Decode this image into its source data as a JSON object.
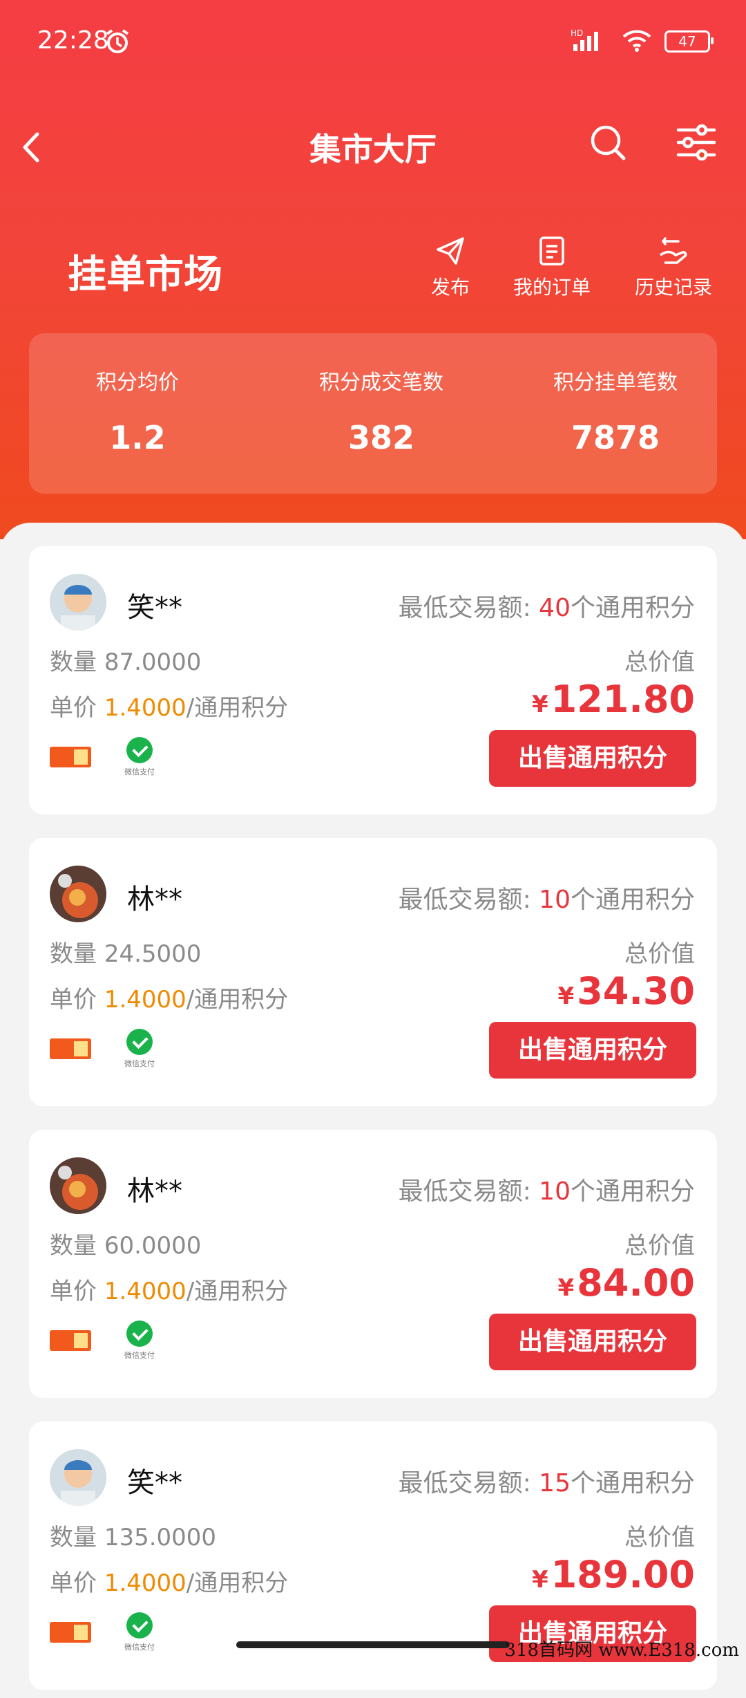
{
  "status_bar": {
    "time": "22:28",
    "network": "HD",
    "battery": "47"
  },
  "nav": {
    "title": "集市大厅"
  },
  "market": {
    "title": "挂单市场",
    "actions": [
      {
        "label": "发布",
        "icon": "send-icon"
      },
      {
        "label": "我的订单",
        "icon": "order-icon"
      },
      {
        "label": "历史记录",
        "icon": "history-icon"
      }
    ]
  },
  "stats": [
    {
      "label": "积分均价",
      "value": "1.2"
    },
    {
      "label": "积分成交笔数",
      "value": "382"
    },
    {
      "label": "积分挂单笔数",
      "value": "7878"
    }
  ],
  "listing_labels": {
    "min_prefix": "最低交易额:",
    "min_suffix": "个通用积分",
    "qty_prefix": "数量",
    "price_prefix": "单价",
    "price_suffix": "/通用积分",
    "total_label": "总价值",
    "currency": "¥",
    "sell_button": "出售通用积分",
    "wechat_pay": "微信支付"
  },
  "listings": [
    {
      "user": "笑**",
      "min_amount": "40",
      "quantity": "87.0000",
      "unit_price": "1.4000",
      "total": "121.80"
    },
    {
      "user": "林**",
      "min_amount": "10",
      "quantity": "24.5000",
      "unit_price": "1.4000",
      "total": "34.30"
    },
    {
      "user": "林**",
      "min_amount": "10",
      "quantity": "60.0000",
      "unit_price": "1.4000",
      "total": "84.00"
    },
    {
      "user": "笑**",
      "min_amount": "15",
      "quantity": "135.0000",
      "unit_price": "1.4000",
      "total": "189.00"
    }
  ],
  "watermark": "318首码网 www.E318.com",
  "colors": {
    "primary_red": "#e8353c",
    "price_orange": "#f08a00",
    "hero_top": "#f53d44",
    "hero_bottom": "#ef4a1f"
  }
}
